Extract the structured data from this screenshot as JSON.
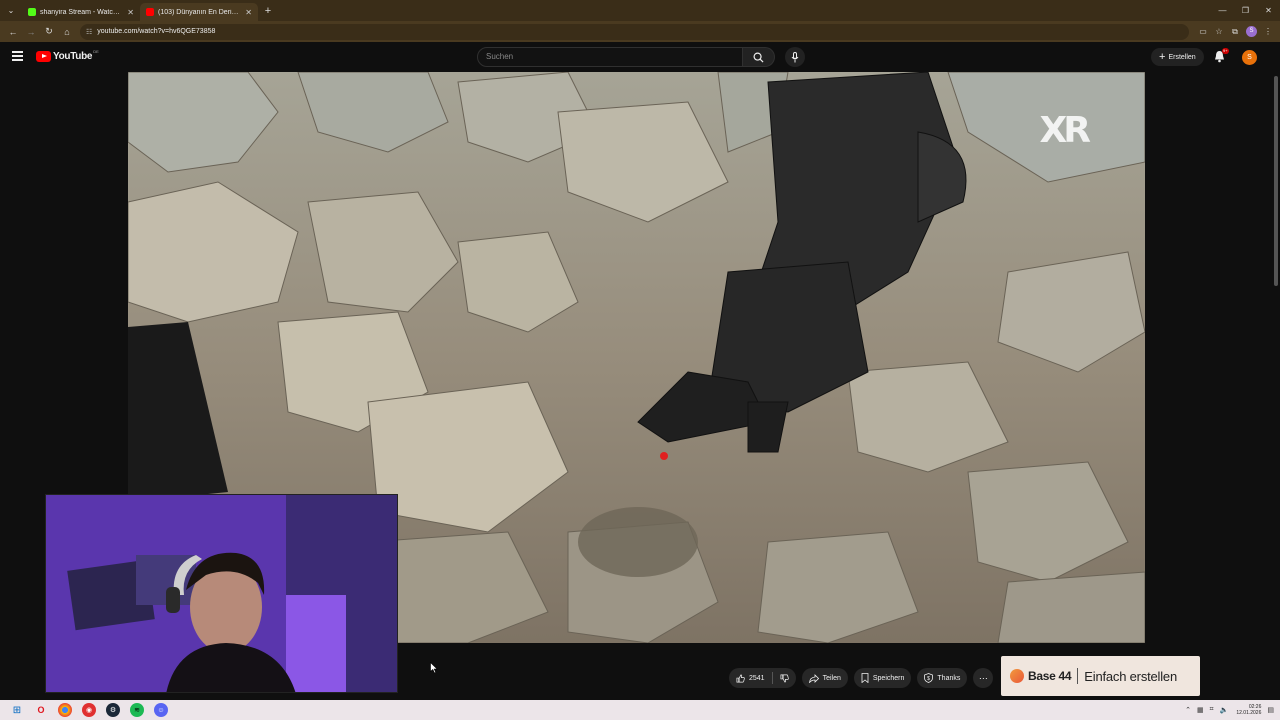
{
  "browser": {
    "tabs": [
      {
        "title": "shanyira Stream - Watch Live o...",
        "favicon_color": "#53fc18",
        "active": false
      },
      {
        "title": "(103) Dünyanın En Derin Nokta...",
        "favicon_color": "#ff0000",
        "active": true
      }
    ],
    "url": "youtube.com/watch?v=hv6QGE73858",
    "profile_initial": "S"
  },
  "youtube": {
    "logo_text": "YouTube",
    "region": "DE",
    "search_placeholder": "Suchen",
    "create_label": "Erstellen",
    "notification_badge": "9+",
    "avatar_initial": "S"
  },
  "video": {
    "watermark": "XR"
  },
  "actions": {
    "like_count": "2541",
    "share_label": "Teilen",
    "save_label": "Speichern",
    "thanks_label": "Thanks"
  },
  "ad": {
    "brand": "Base 44",
    "cta": "Einfach erstellen"
  },
  "taskbar": {
    "time": "02:26",
    "date": "12.01.2026"
  },
  "colors": {
    "youtube_red": "#ff0000",
    "browser_chrome": "#3a2d18",
    "background": "#0f0f0f"
  }
}
